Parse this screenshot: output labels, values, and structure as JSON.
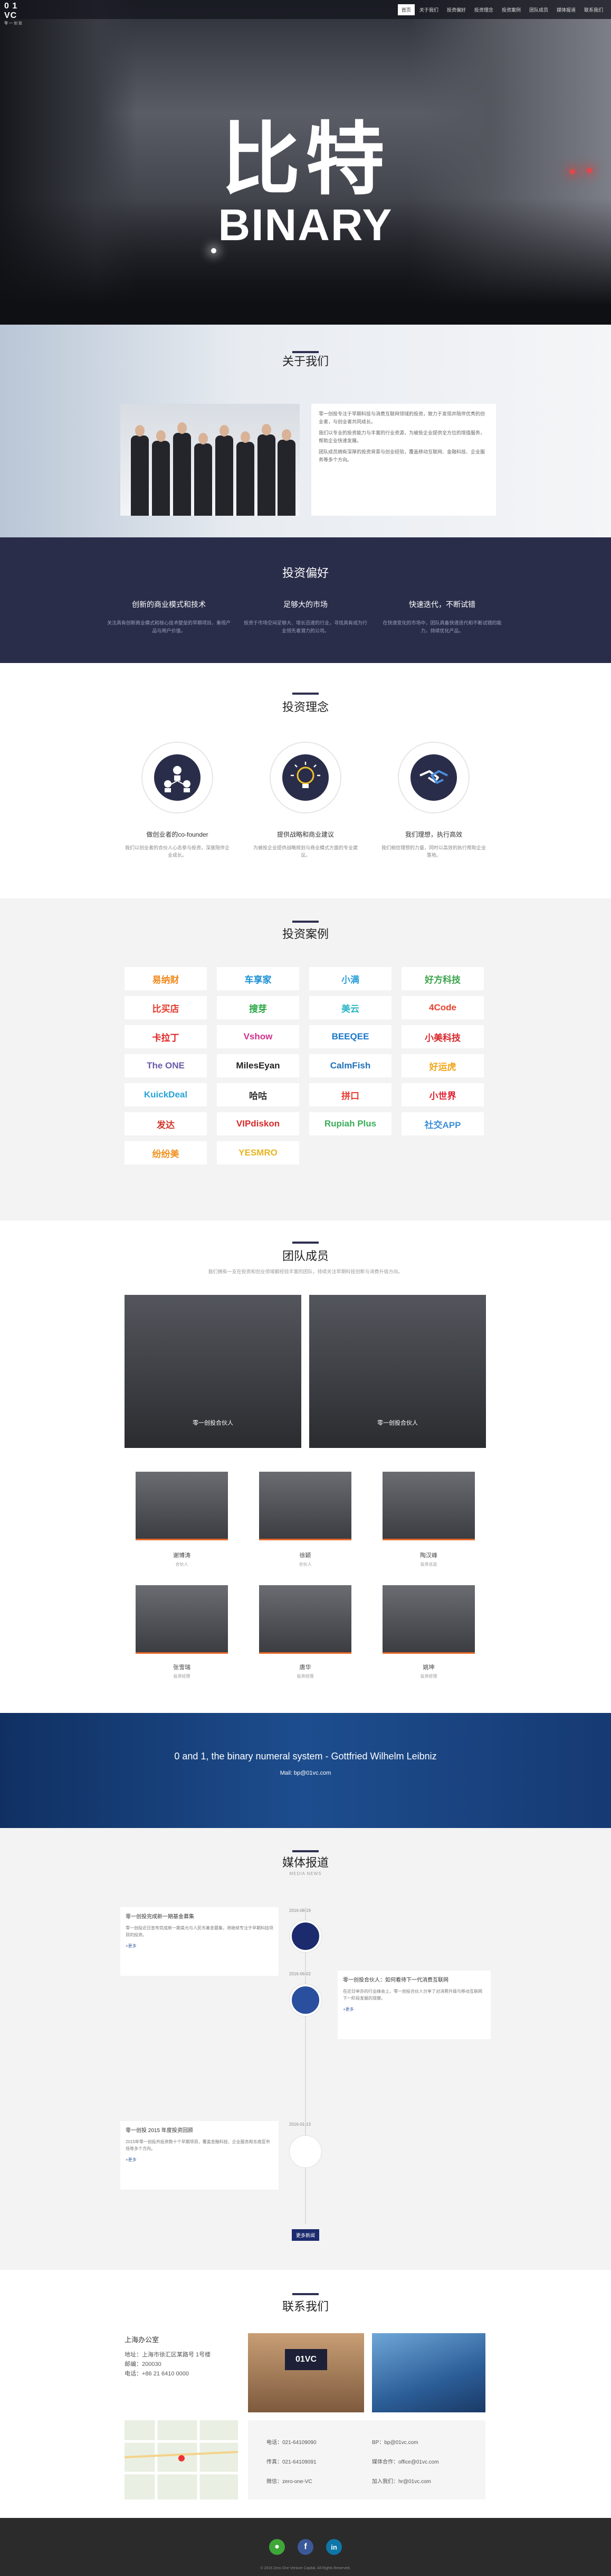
{
  "nav": {
    "logo_text": "0 1 VC",
    "logo_sub": "零一创投",
    "items": [
      "首页",
      "关于我们",
      "投资偏好",
      "投资理念",
      "投资案例",
      "团队成员",
      "媒体报道",
      "联系我们"
    ]
  },
  "hero": {
    "title_cn": "比特",
    "title_en": "BINARY"
  },
  "about": {
    "title": "关于我们",
    "paragraphs": [
      "零一创投专注于早期科技与消费互联网领域的投资，致力于发现并陪伴优秀的创业者，与创业者共同成长。",
      "我们以专业的投资能力与丰富的行业资源，为被投企业提供全方位的增值服务，帮助企业快速发展。",
      "团队成员拥有深厚的投资背景与创业经验，覆盖移动互联网、金融科技、企业服务等多个方向。"
    ]
  },
  "prefs": {
    "title": "投资偏好",
    "items": [
      {
        "title": "创新的商业模式和技术",
        "desc": "关注具有创新商业模式和核心技术壁垒的早期项目，重视产品与用户价值。"
      },
      {
        "title": "足够大的市场",
        "desc": "投资于市场空间足够大、增长迅速的行业，寻找具有成为行业领先者潜力的公司。"
      },
      {
        "title": "快速迭代，不断试错",
        "desc": "在快速变化的市场中，团队具备快速迭代和不断试错的能力，持续优化产品。"
      }
    ]
  },
  "concept": {
    "title": "投资理念",
    "items": [
      {
        "title": "做创业者的co-founder",
        "desc": "我们以创业者的合伙人心态参与投资，深度陪伴企业成长。",
        "icon": "team-icon"
      },
      {
        "title": "提供战略和商业建议",
        "desc": "为被投企业提供战略规划与商业模式方面的专业建议。",
        "icon": "lightbulb-icon"
      },
      {
        "title": "我们理想，执行高效",
        "desc": "我们相信理想的力量，同时以高效的执行帮助企业落地。",
        "icon": "handshake-icon"
      }
    ]
  },
  "cases": {
    "title": "投资案例",
    "logos": [
      {
        "name": "易纳财",
        "color": "#f08a1c"
      },
      {
        "name": "车享家",
        "color": "#1a8fd6"
      },
      {
        "name": "小满",
        "color": "#2a9fd8"
      },
      {
        "name": "好方科技",
        "color": "#3aa34a"
      },
      {
        "name": "比买店",
        "color": "#e33b2e"
      },
      {
        "name": "搜芽",
        "color": "#28a745"
      },
      {
        "name": "美云",
        "color": "#2bb5c4"
      },
      {
        "name": "4Code",
        "color": "#e5412e"
      },
      {
        "name": "卡拉丁",
        "color": "#e02020"
      },
      {
        "name": "Vshow",
        "color": "#d0308a"
      },
      {
        "name": "BEEQEE",
        "color": "#1976c9"
      },
      {
        "name": "小美科技",
        "color": "#d8262b"
      },
      {
        "name": "The ONE",
        "color": "#6b5ba8"
      },
      {
        "name": "MilesEyan",
        "color": "#222222"
      },
      {
        "name": "CalmFish",
        "color": "#1f70b8"
      },
      {
        "name": "好运虎",
        "color": "#f2a51a"
      },
      {
        "name": "KuickDeal",
        "color": "#29a3d6"
      },
      {
        "name": "哈咕",
        "color": "#333333"
      },
      {
        "name": "拼口",
        "color": "#e8392c"
      },
      {
        "name": "小世界",
        "color": "#e02030"
      },
      {
        "name": "发达",
        "color": "#d33528"
      },
      {
        "name": "VIPdiskon",
        "color": "#d82a2a"
      },
      {
        "name": "Rupiah Plus",
        "color": "#3bae5a"
      },
      {
        "name": "社交APP",
        "color": "#3d8ed8"
      },
      {
        "name": "纷纷美",
        "color": "#f0901e"
      },
      {
        "name": "YESMRO",
        "color": "#e8b420"
      }
    ]
  },
  "team": {
    "title": "团队成员",
    "intro": "我们拥有一支在投资和创业领域都经验丰富的团队，持续关注早期科技创新与消费升级方向。",
    "partners": [
      {
        "caption": "零一创投合伙人"
      },
      {
        "caption": "零一创投合伙人"
      }
    ],
    "members": [
      {
        "name": "谢博涛",
        "role": "合伙人"
      },
      {
        "name": "徐颖",
        "role": "合伙人"
      },
      {
        "name": "陶汉峰",
        "role": "投资总监"
      },
      {
        "name": "张雪瑞",
        "role": "投资经理"
      },
      {
        "name": "唐华",
        "role": "投资经理"
      },
      {
        "name": "姚坤",
        "role": "投资经理"
      }
    ]
  },
  "quote": {
    "text": "0 and 1, the binary numeral system - Gottfried Wilhelm Leibniz",
    "mail_label": "Mail:",
    "mail": "bp@01vc.com"
  },
  "media": {
    "title": "媒体报道",
    "subtitle": "MEDIA NEWS",
    "posts": [
      {
        "title": "零一创投完成新一期基金募集",
        "date": "2016-08-19",
        "body": "零一创投近日宣布完成新一期美元与人民币基金募集，将继续专注于早期科技项目的投资。",
        "more": "+更多"
      },
      {
        "title": "零一创投合伙人：如何看待下一代消费互联网",
        "date": "2016-06-02",
        "body": "在近日举办的行业峰会上，零一创投合伙人分享了对消费升级与移动互联网下一阶段发展的观察。",
        "more": "+更多"
      },
      {
        "title": "零一创投 2015 年度投资回顾",
        "date": "2016-01-13",
        "body": "2015年零一创投共投资数十个早期项目，覆盖金融科技、企业服务和东南亚市场等多个方向。",
        "more": "+更多"
      }
    ],
    "more_button": "更多新闻"
  },
  "contact": {
    "title": "联系我们",
    "office": "上海办公室",
    "address": "地址：上海市徐汇区某路号 1号楼",
    "zip": "邮编：200030",
    "phone": "电话：+86 21 6410 0000",
    "rows": [
      {
        "label": "电话：021-64109090",
        "value": "BP：bp@01vc.com"
      },
      {
        "label": "传真：021-64109091",
        "value": "媒体合作：office@01vc.com"
      },
      {
        "label": "微信：zero-one-VC",
        "value": "加入我们：hr@01vc.com"
      }
    ]
  },
  "footer": {
    "copyright": "© 2016 Zero One Venture Capital. All Rights Reserved.",
    "icons": [
      "wechat-icon",
      "facebook-icon",
      "linkedin-icon"
    ]
  }
}
